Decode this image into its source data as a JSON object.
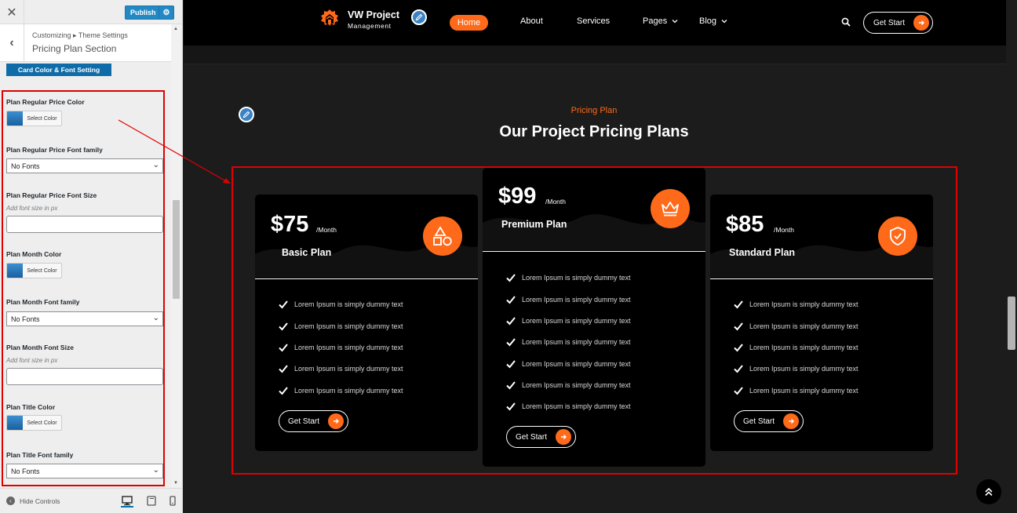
{
  "customizer": {
    "close_glyph": "✕",
    "publish_label": "Publish",
    "breadcrumb": "Customizing ▸ Theme Settings",
    "section_title": "Pricing Plan Section",
    "section_tab": "Card Color & Font Setting",
    "controls": {
      "regular_price_color_label": "Plan Regular Price Color",
      "regular_price_font_family_label": "Plan Regular Price Font family",
      "regular_price_font_size_label": "Plan Regular Price Font Size",
      "month_color_label": "Plan Month Color",
      "month_font_family_label": "Plan Month Font family",
      "month_font_size_label": "Plan Month Font Size",
      "title_color_label": "Plan Title Color",
      "title_font_family_label": "Plan Title Font family",
      "select_color": "Select Color",
      "font_select_value": "No Fonts",
      "font_size_desc": "Add font size in px"
    },
    "hide_controls": "Hide Controls"
  },
  "site": {
    "logo_title": "VW Project",
    "logo_sub": "Management",
    "nav": {
      "home": "Home",
      "about": "About",
      "services": "Services",
      "pages": "Pages",
      "blog": "Blog",
      "cta": "Get Start"
    },
    "section_kicker": "Pricing Plan",
    "section_title": "Our Project Pricing Plans",
    "accent": "#ff6a1a",
    "plans": [
      {
        "price": "$75",
        "period": "/Month",
        "name": "Basic Plan",
        "icon": "shapes-icon",
        "features": [
          "Lorem Ipsum is simply dummy text",
          "Lorem Ipsum is simply dummy text",
          "Lorem Ipsum is simply dummy text",
          "Lorem Ipsum is simply dummy text",
          "Lorem Ipsum is simply dummy text"
        ],
        "cta": "Get Start"
      },
      {
        "price": "$99",
        "period": "/Month",
        "name": "Premium Plan",
        "icon": "crown-icon",
        "features": [
          "Lorem Ipsum is simply dummy text",
          "Lorem Ipsum is simply dummy text",
          "Lorem Ipsum is simply dummy text",
          "Lorem Ipsum is simply dummy text",
          "Lorem Ipsum is simply dummy text",
          "Lorem Ipsum is simply dummy text",
          "Lorem Ipsum is simply dummy text"
        ],
        "cta": "Get Start"
      },
      {
        "price": "$85",
        "period": "/Month",
        "name": "Standard Plan",
        "icon": "shield-check-icon",
        "features": [
          "Lorem Ipsum is simply dummy text",
          "Lorem Ipsum is simply dummy text",
          "Lorem Ipsum is simply dummy text",
          "Lorem Ipsum is simply dummy text",
          "Lorem Ipsum is simply dummy text"
        ],
        "cta": "Get Start"
      }
    ]
  }
}
